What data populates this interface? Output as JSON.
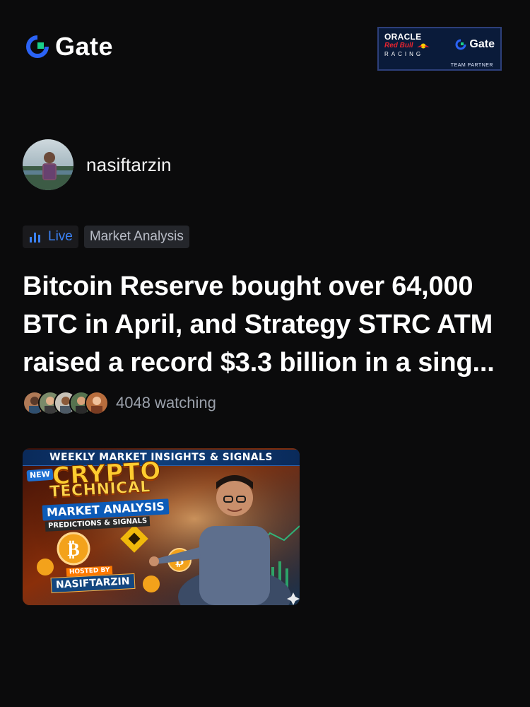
{
  "header": {
    "brand_name": "Gate",
    "brand_icon": "gate-logo-icon",
    "partner_badge": {
      "line1": "ORACLE",
      "line2": "Red Bull",
      "line3": "RACING",
      "brand_name": "Gate",
      "caption": "TEAM PARTNER"
    }
  },
  "author": {
    "name": "nasiftarzin",
    "avatar_icon": "author-avatar"
  },
  "tags": {
    "live_label": "Live",
    "category_label": "Market Analysis",
    "live_color": "#3b82f6"
  },
  "post": {
    "title": "Bitcoin Reserve bought over 64,000 BTC in April, and Strategy STRC ATM raised a record $3.3 billion in a sing..."
  },
  "watchers": {
    "count_text": "4048 watching",
    "avatars": [
      "watcher-1",
      "watcher-2",
      "watcher-3",
      "watcher-4",
      "watcher-5"
    ]
  },
  "thumbnail": {
    "banner": "WEEKLY MARKET INSIGHTS & SIGNALS",
    "new_label": "NEW",
    "headline1": "CRYPTO",
    "headline2": "TECHNICAL",
    "headline3": "MARKET ANALYSIS",
    "subline": "PREDICTIONS & SIGNALS",
    "hosted_by": "HOSTED BY",
    "host_name": "NASIFTARZIN"
  },
  "colors": {
    "background": "#0b0b0c",
    "text_primary": "#ffffff",
    "text_secondary": "#9aa0aa",
    "accent_blue": "#3b82f6"
  }
}
